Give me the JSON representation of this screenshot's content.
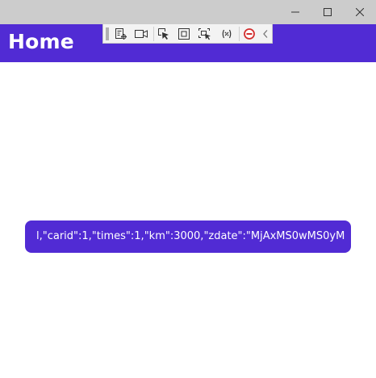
{
  "window": {
    "controls": {
      "minimize_icon": "minimize-icon",
      "maximize_icon": "maximize-icon",
      "close_icon": "close-icon"
    }
  },
  "header": {
    "title": "Home",
    "background": "#512bd4"
  },
  "debug_toolbar": {
    "tools": [
      "live-visual-tree-icon",
      "record-icon",
      "select-element-icon",
      "display-layout-adorners-icon",
      "track-focused-element-icon",
      "binding-failures-icon",
      "hot-reload-stop-icon",
      "collapse-chevron-icon"
    ]
  },
  "main": {
    "button_text": "l,\"carid\":1,\"times\":1,\"km\":3000,\"zdate\":\"MjAxMS0wMS0yM",
    "accent": "#512bd4"
  }
}
